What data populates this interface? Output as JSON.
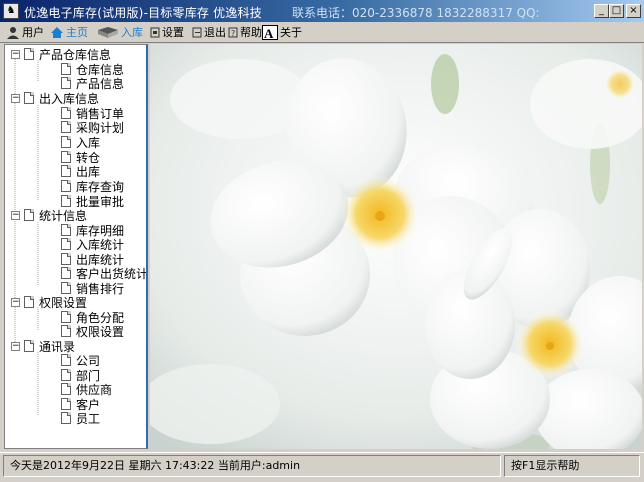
{
  "window": {
    "title": "优逸电子库存(试用版)-目标零库存 优逸科技",
    "contact": "联系电话：020-2336878  1832288317  QQ:",
    "minimize_glyph": "_",
    "maximize_glyph": "□",
    "close_glyph": "×",
    "app_icon_glyph": "♞"
  },
  "toolbar": {
    "items": [
      {
        "label": "用户",
        "icon": "user-icon"
      },
      {
        "label": "主页",
        "icon": "home-icon"
      },
      {
        "label": "入库",
        "icon": "stock-in-icon"
      },
      {
        "label": "设置",
        "icon": "settings-icon"
      },
      {
        "label": "退出",
        "icon": "exit-icon"
      },
      {
        "label": "帮助",
        "icon": "help-icon"
      },
      {
        "label": "关于",
        "icon": "about-icon"
      }
    ]
  },
  "tree": {
    "groups": [
      {
        "label": "产品仓库信息",
        "children": [
          "仓库信息",
          "产品信息"
        ]
      },
      {
        "label": "出入库信息",
        "children": [
          "销售订单",
          "采购计划",
          "入库",
          "转仓",
          "出库",
          "库存查询",
          "批量审批"
        ]
      },
      {
        "label": "统计信息",
        "children": [
          "库存明细",
          "入库统计",
          "出库统计",
          "客户出货统计",
          "销售排行"
        ]
      },
      {
        "label": "权限设置",
        "children": [
          "角色分配",
          "权限设置"
        ]
      },
      {
        "label": "通讯录",
        "children": [
          "公司",
          "部门",
          "供应商",
          "客户",
          "员工"
        ]
      }
    ],
    "expander_glyph": "−"
  },
  "status": {
    "datetime_user": "今天是2012年9月22日 星期六 17:43:22 当前用户:admin",
    "help": "按F1显示帮助"
  },
  "colors": {
    "titlebar_start": "#0a246a",
    "tree_border": "#2d6db3",
    "window_bg": "#d4d0c8"
  }
}
